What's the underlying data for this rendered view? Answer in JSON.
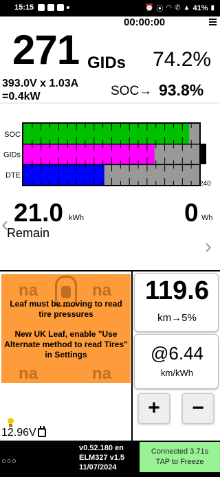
{
  "status_bar": {
    "time": "15:15",
    "battery": "41%",
    "icons": [
      "notification-icon",
      "notification-icon",
      "message-icon",
      "dot-icon",
      "alarm-icon",
      "location-icon",
      "wifi-icon",
      "call-icon",
      "signal-icon",
      "battery-icon"
    ]
  },
  "header": {
    "timer": "00:00:00",
    "menu_icon": "hamburger-menu-icon"
  },
  "gids": {
    "value": "271",
    "label": "GIDs",
    "percent": "74.2%"
  },
  "electrical": {
    "line1": "393.0V x 1.03A",
    "line2": "=0.4kW"
  },
  "soc": {
    "label": "SOC→",
    "value": "93.8%"
  },
  "chart_data": {
    "type": "bar",
    "orientation": "horizontal",
    "categories": [
      "SOC",
      "GIDs",
      "DTE"
    ],
    "values": [
      93.8,
      74.2,
      45.8
    ],
    "xlim": [
      0,
      100
    ],
    "max_label": "240",
    "colors": [
      "#00c000",
      "#ff00ff",
      "#0000ff"
    ],
    "background_color": "#999999"
  },
  "remain": {
    "value": "21.0",
    "unit": "kWh",
    "label": "Remain",
    "wh_value": "0",
    "wh_unit": "Wh"
  },
  "tires": {
    "na_labels": [
      "na",
      "na",
      "na",
      "na"
    ],
    "message1": "Leaf must be moving to read tire pressures",
    "message2": "New UK Leaf, enable \"Use Alternate method to read Tires\" in Settings",
    "color": "#fe9b3a"
  },
  "range": {
    "value": "119.6",
    "sub": "km→5%"
  },
  "efficiency": {
    "value": "@6.44",
    "unit": "km/kWh"
  },
  "buttons": {
    "plus": "+",
    "minus": "−"
  },
  "aux_battery": {
    "voltage": "12.96V"
  },
  "footer": {
    "dots": "○○○",
    "version": "v0.52.180 en",
    "adapter": "ELM327 v1.5",
    "date": "11/07/2024",
    "connect_line1": "Connected 3.71s",
    "connect_line2": "TAP to Freeze"
  }
}
